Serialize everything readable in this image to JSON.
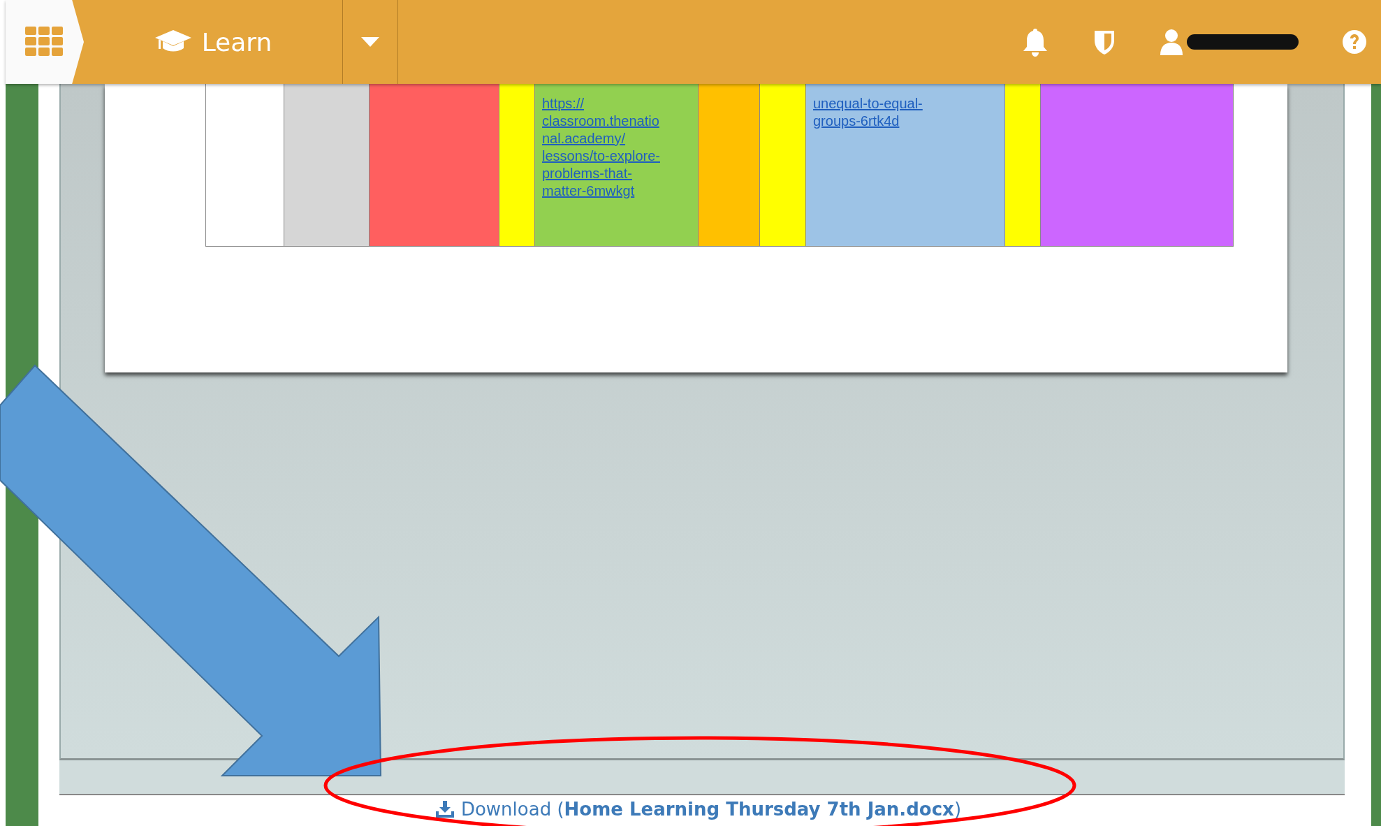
{
  "top_bar": {
    "app_label": "Learn"
  },
  "table_row": [
    {
      "color": "#ffffff"
    },
    {
      "color": "#d6d6d6"
    },
    {
      "color": "#ff5f5f"
    },
    {
      "color": "#ffff00"
    },
    {
      "color": "#92d050",
      "link": "https://\nclassroom.thenatio\nnal.academy/\nlessons/to-explore-\nproblems-that-\nmatter-6mwkgt"
    },
    {
      "color": "#ffc000"
    },
    {
      "color": "#ffff00"
    },
    {
      "color": "#9dc3e6",
      "link": "unequal-to-equal-\ngroups-6rtk4d"
    },
    {
      "color": "#ffff00"
    },
    {
      "color": "#cc66ff"
    }
  ],
  "download": {
    "text": "Download (**Home Learning Thursday 7th Jan.docx**)"
  }
}
